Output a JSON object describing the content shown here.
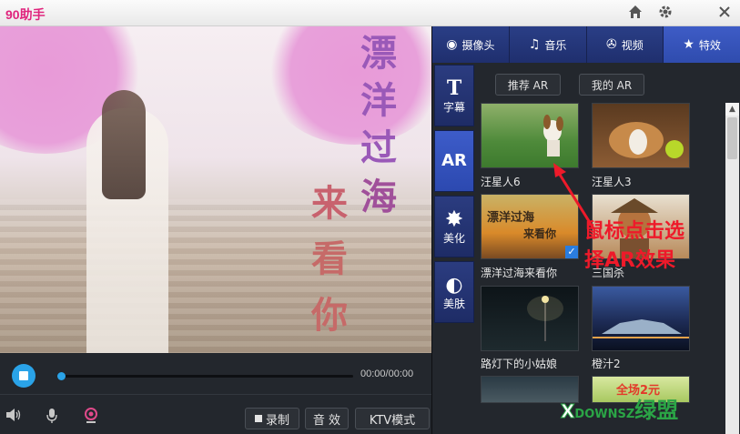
{
  "app": {
    "title": "90助手"
  },
  "window_controls": {
    "home_icon": "⌂",
    "settings_icon": "⚙",
    "close_icon": "✕"
  },
  "video": {
    "overlay_text": [
      "漂",
      "洋",
      "过",
      "海",
      "来",
      "看",
      "你"
    ]
  },
  "player": {
    "time": "00:00/00:00",
    "progress": 0,
    "buttons": {
      "record": "录制",
      "sound_effect": "音 效",
      "ktv_mode": "KTV模式"
    }
  },
  "tabs": [
    {
      "label": "摄像头",
      "icon": "webcam-icon"
    },
    {
      "label": "音乐",
      "icon": "music-note-icon"
    },
    {
      "label": "视频",
      "icon": "film-reel-icon"
    },
    {
      "label": "特效",
      "icon": "star-icon",
      "active": true
    }
  ],
  "side_tabs": [
    {
      "glyph": "T",
      "label": "字幕"
    },
    {
      "glyph": "AR",
      "label": "",
      "active": true
    },
    {
      "glyph": "✸",
      "label": "美化"
    },
    {
      "glyph": "◐",
      "label": "美肤"
    }
  ],
  "sub_tabs": {
    "recommended": "推荐 AR",
    "mine": "我的 AR"
  },
  "ar_items": [
    {
      "label": "汪星人6"
    },
    {
      "label": "汪星人3"
    },
    {
      "label": "漂洋过海来看你",
      "selected": true,
      "thumb_text": "漂洋过海",
      "thumb_sub": "来看你"
    },
    {
      "label": "三国杀"
    },
    {
      "label": "路灯下的小姑娘"
    },
    {
      "label": "橙汁2"
    }
  ],
  "bottom_thumb_text": "全场2元",
  "annotation": {
    "line1": "鼠标点击选",
    "line2": "择AR效果"
  },
  "watermark": {
    "brand": "DOWNSZ",
    "cn": "绿盟"
  },
  "colors": {
    "accent": "#2aa3e8",
    "tab_active": "#3e5cc6",
    "annotation": "#ee1a2a",
    "title": "#e0247d"
  }
}
